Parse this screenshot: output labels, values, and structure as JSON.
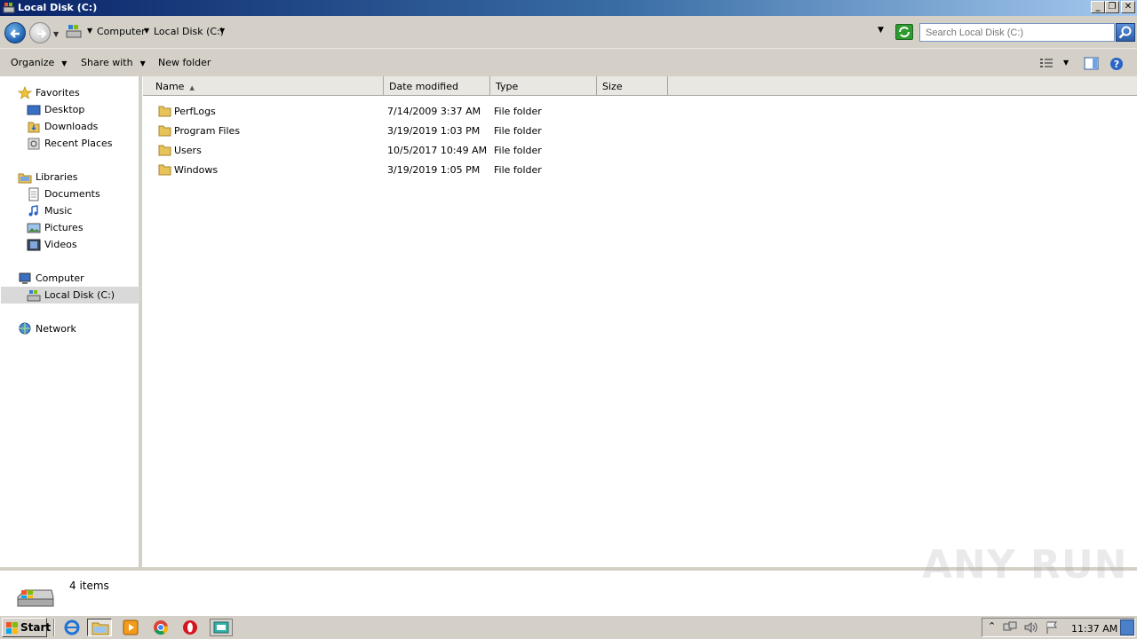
{
  "window": {
    "title": "Local Disk (C:)",
    "minimize": "_",
    "restore": "❐",
    "close": "✕"
  },
  "address": {
    "crumbs": [
      "Computer",
      "Local Disk (C:)"
    ],
    "search_placeholder": "Search Local Disk (C:)"
  },
  "command_bar": {
    "organize": "Organize",
    "share_with": "Share with",
    "new_folder": "New folder"
  },
  "nav": {
    "favorites": "Favorites",
    "desktop": "Desktop",
    "downloads": "Downloads",
    "recent_places": "Recent Places",
    "libraries": "Libraries",
    "documents": "Documents",
    "music": "Music",
    "pictures": "Pictures",
    "videos": "Videos",
    "computer": "Computer",
    "local_disk": "Local Disk (C:)",
    "network": "Network"
  },
  "columns": {
    "name": "Name",
    "date_modified": "Date modified",
    "type": "Type",
    "size": "Size"
  },
  "files": [
    {
      "name": "PerfLogs",
      "date": "7/14/2009 3:37 AM",
      "type": "File folder",
      "size": ""
    },
    {
      "name": "Program Files",
      "date": "3/19/2019 1:03 PM",
      "type": "File folder",
      "size": ""
    },
    {
      "name": "Users",
      "date": "10/5/2017 10:49 AM",
      "type": "File folder",
      "size": ""
    },
    {
      "name": "Windows",
      "date": "3/19/2019 1:05 PM",
      "type": "File folder",
      "size": ""
    }
  ],
  "details": {
    "item_count": "4 items"
  },
  "watermark": "ANY RUN",
  "taskbar": {
    "start": "Start",
    "clock": "11:37 AM"
  },
  "colors": {
    "title_bar": "#0a246a",
    "chrome": "#d4d0c8",
    "selection": "#d9d9d9",
    "folder": "#e8c35a"
  }
}
